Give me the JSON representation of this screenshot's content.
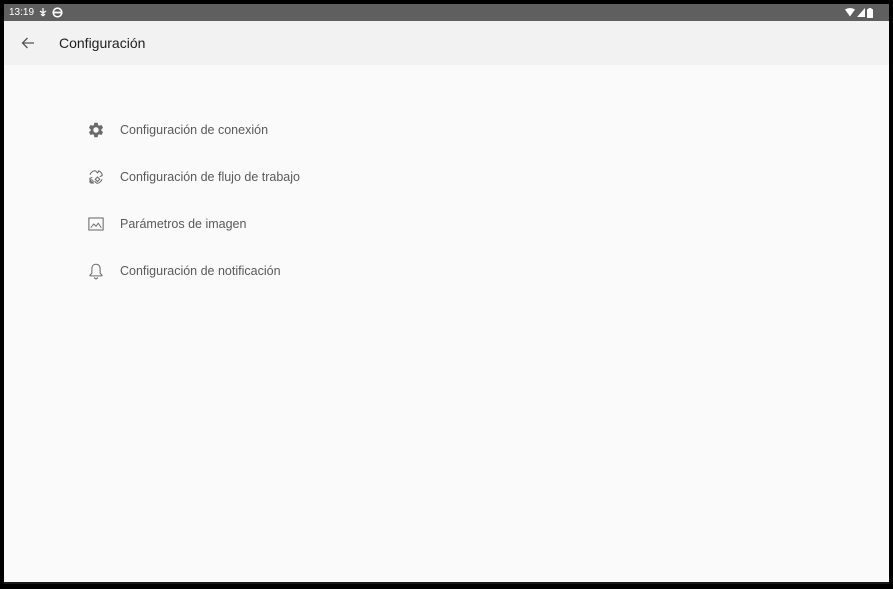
{
  "status_bar": {
    "time": "13:19",
    "left_icons": [
      "usb-icon",
      "sync-icon"
    ],
    "right_icons": [
      "wifi-icon",
      "signal-icon",
      "battery-icon"
    ]
  },
  "app_bar": {
    "back_icon": "arrow-left-icon",
    "title": "Configuración"
  },
  "settings": {
    "items": [
      {
        "label": "Configuración de conexión",
        "icon": "gear-icon"
      },
      {
        "label": "Configuración de flujo de trabajo",
        "icon": "workflow-icon"
      },
      {
        "label": "Parámetros de imagen",
        "icon": "image-icon"
      },
      {
        "label": "Configuración de notificación",
        "icon": "bell-icon"
      }
    ]
  },
  "colors": {
    "status_bar": "#5f5f5f",
    "app_bar": "#f2f2f2",
    "background": "#fafafa",
    "icon": "#6b6b6b",
    "text": "#5a5a5a"
  }
}
